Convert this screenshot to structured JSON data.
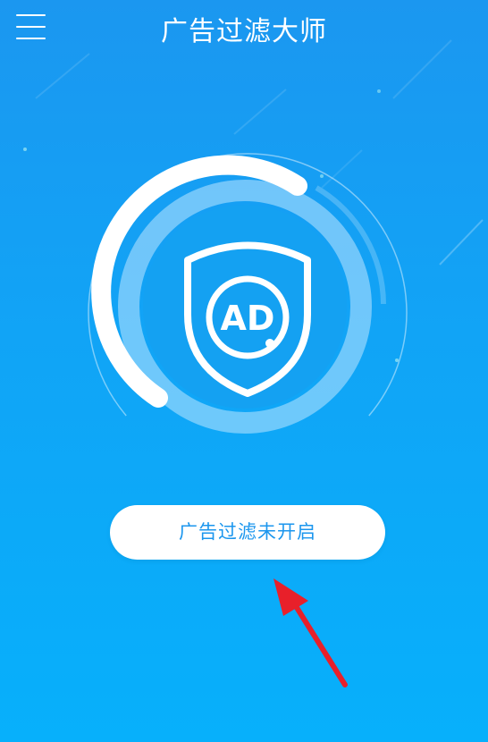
{
  "header": {
    "menu_icon": "hamburger-menu-icon",
    "title": "广告过滤大师"
  },
  "filter": {
    "logo_text": "AD",
    "logo_icon": "ad-shield-icon",
    "status_label": "广告过滤未开启"
  },
  "annotation": {
    "icon": "red-arrow-icon",
    "color": "#e8202a"
  },
  "theme": {
    "background_top": "#1b97f0",
    "background_bottom": "#07b0fb",
    "button_text_color": "#1b96ee"
  }
}
